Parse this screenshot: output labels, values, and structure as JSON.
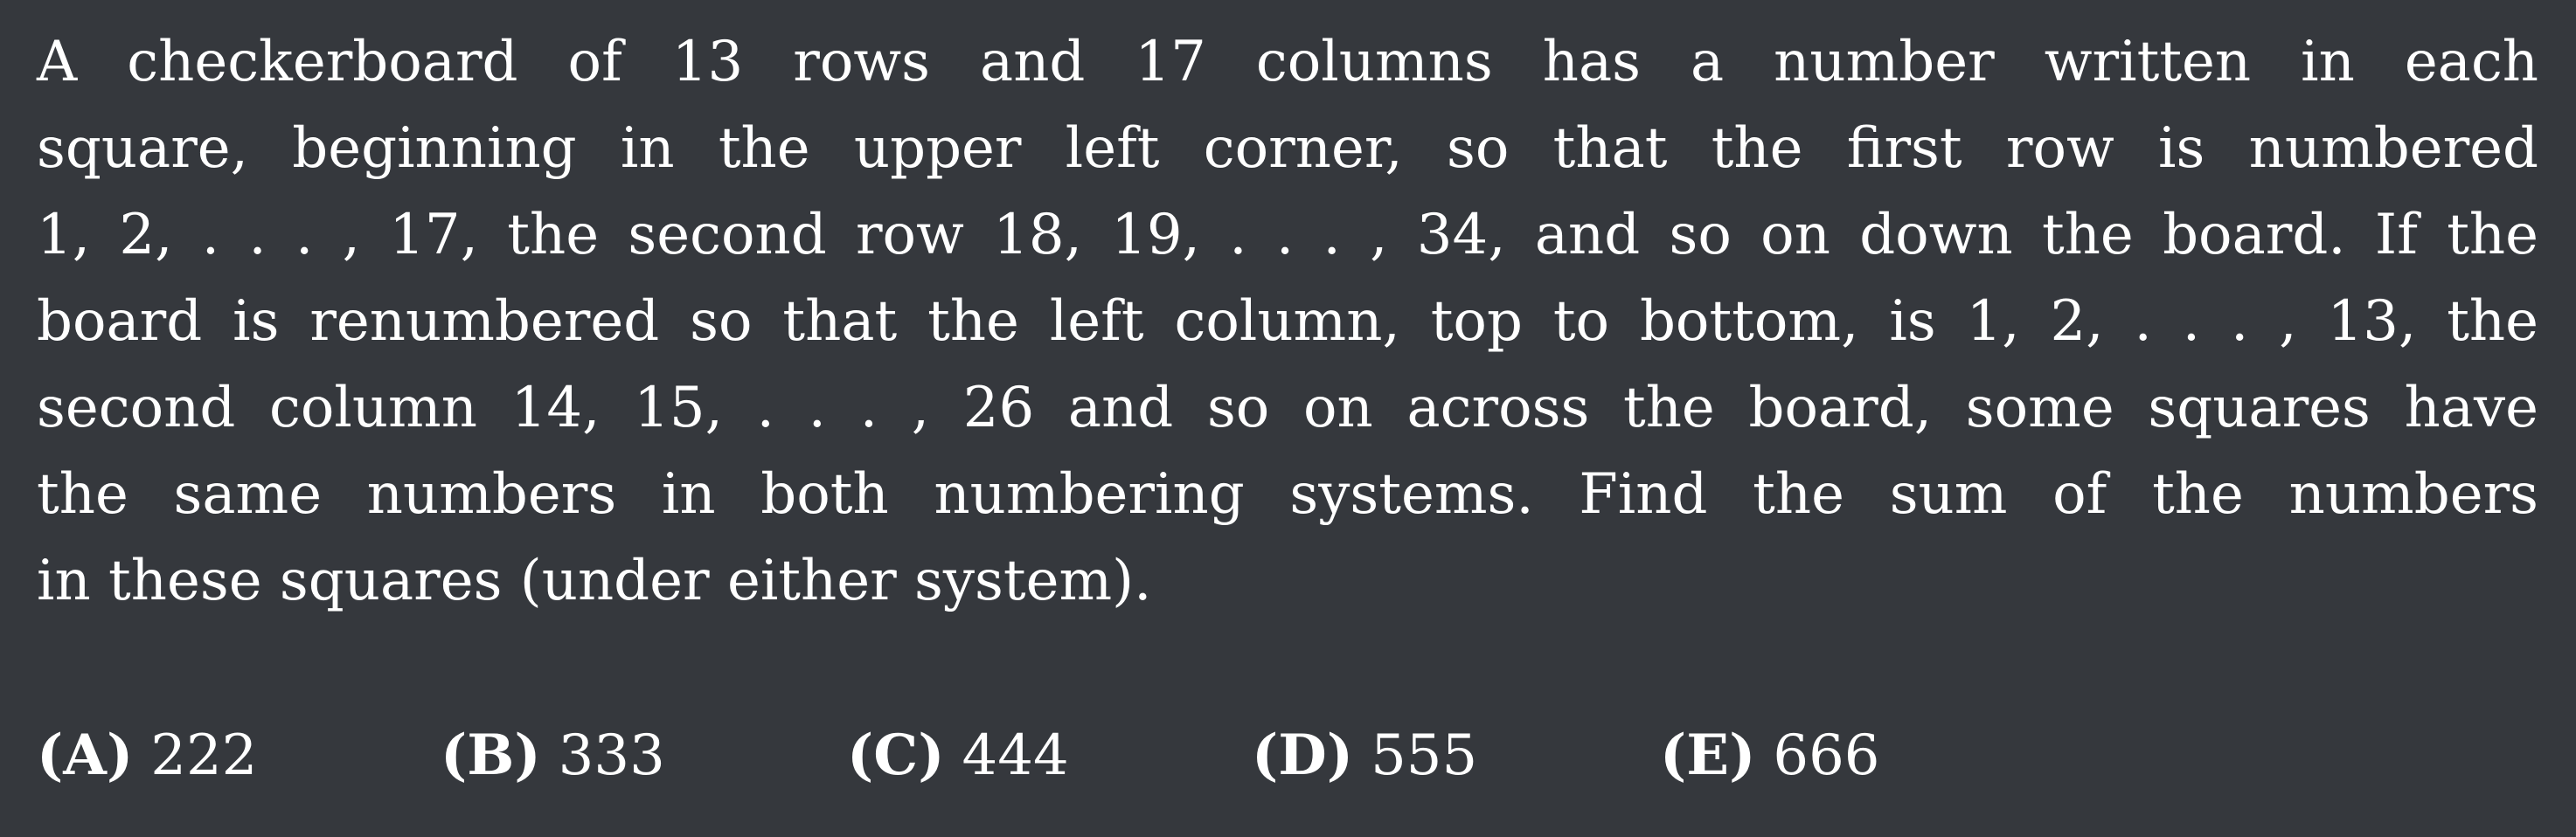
{
  "problem": {
    "lines": [
      "A checkerboard of 13 rows and 17 columns has a number written in each",
      "square, beginning in the upper left corner, so that the first row is numbered",
      "1, 2, . . . , 17, the second row 18, 19, . . . , 34, and so on down the board. If the",
      "board is renumbered so that the left column, top to bottom, is 1, 2, . . . , 13, the",
      "second column 14, 15, . . . , 26 and so on across the board, some squares have",
      "the same numbers in both numbering systems. Find the sum of the numbers",
      "in these squares (under either system)."
    ]
  },
  "choices": [
    {
      "letter": "(A)",
      "value": "222"
    },
    {
      "letter": "(B)",
      "value": "333"
    },
    {
      "letter": "(C)",
      "value": "444"
    },
    {
      "letter": "(D)",
      "value": "555"
    },
    {
      "letter": "(E)",
      "value": "666"
    }
  ]
}
